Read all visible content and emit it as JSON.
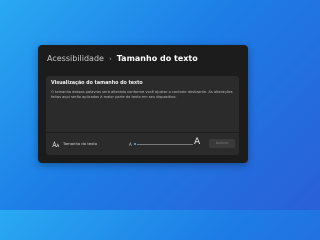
{
  "header": {
    "parent": "Acessibilidade",
    "separator": "›",
    "current": "Tamanho do texto"
  },
  "preview": {
    "title": "Visualização do tamanho do texto",
    "description": "O tamanho dessas palavras será alterado conforme você ajustar o controle deslizante. As alterações feitas aqui serão aplicadas à maior parte do texto em seu dispositivo."
  },
  "text_size_row": {
    "label": "Tamanho do texto",
    "icon": "text-size-icon",
    "small_marker": "A",
    "large_marker": "A",
    "slider_level": 0,
    "apply_label": "Aplicar"
  },
  "colors": {
    "accent": "#56b7ff",
    "window_bg": "#1c1c1c",
    "card_bg": "#2b2b2b"
  }
}
